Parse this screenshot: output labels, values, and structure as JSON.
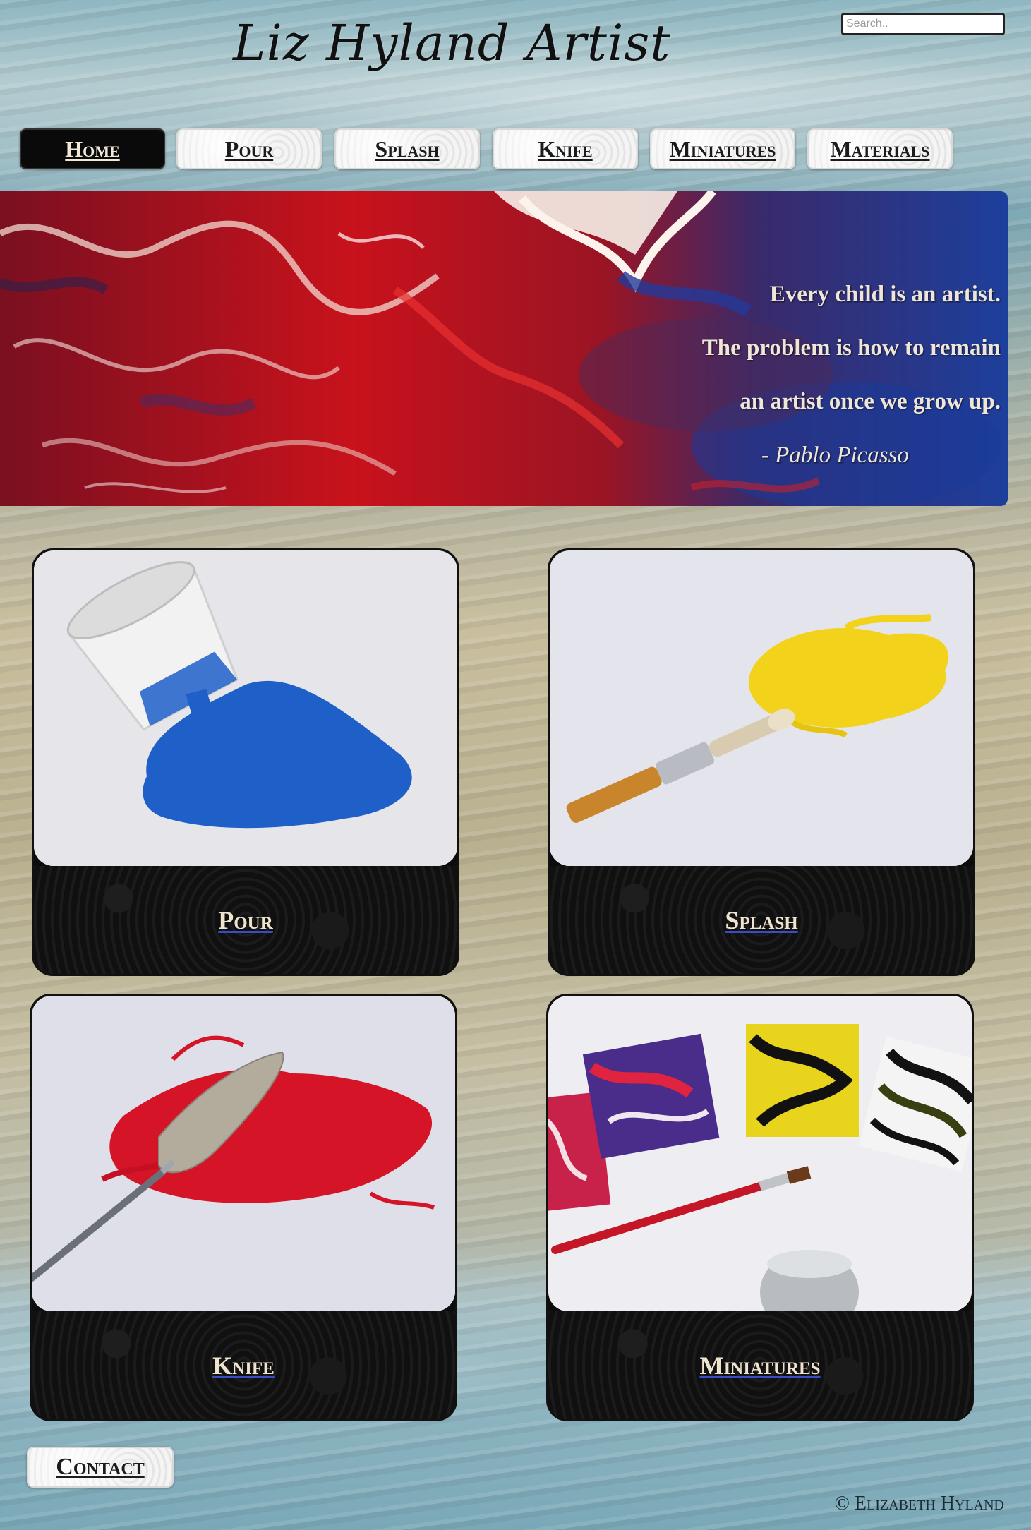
{
  "site": {
    "title": "Liz Hyland Artist"
  },
  "search": {
    "placeholder": "Search.."
  },
  "nav": {
    "items": [
      {
        "label": "Home",
        "active": true
      },
      {
        "label": "Pour"
      },
      {
        "label": "Splash"
      },
      {
        "label": "Knife"
      },
      {
        "label": "Miniatures"
      },
      {
        "label": "Materials"
      }
    ]
  },
  "banner": {
    "quote_lines": [
      "Every child is an artist.",
      "The problem is how to remain",
      "an artist once we grow up."
    ],
    "author": "- Pablo Picasso"
  },
  "gallery": [
    {
      "label": "Pour"
    },
    {
      "label": "Splash"
    },
    {
      "label": "Knife"
    },
    {
      "label": "Miniatures"
    }
  ],
  "footer": {
    "contact_label": "Contact",
    "copyright": "© Elizabeth Hyland"
  },
  "colors": {
    "accent_red": "#c8121c",
    "accent_blue": "#1d4fb0",
    "quote_text": "#efe6d8",
    "caption_text": "#f0e4cf"
  }
}
